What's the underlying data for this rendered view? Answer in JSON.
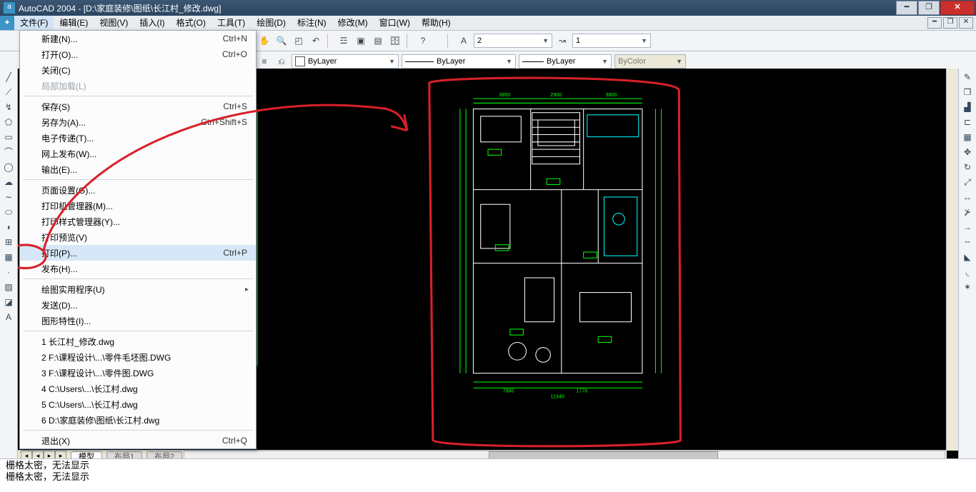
{
  "title": "AutoCAD 2004 - [D:\\家庭装修\\图纸\\长江村_修改.dwg]",
  "menubar": [
    "文件(F)",
    "编辑(E)",
    "视图(V)",
    "插入(I)",
    "格式(O)",
    "工具(T)",
    "绘图(D)",
    "标注(N)",
    "修改(M)",
    "窗口(W)",
    "帮助(H)"
  ],
  "file_menu": {
    "new": {
      "label": "新建(N)...",
      "sc": "Ctrl+N"
    },
    "open": {
      "label": "打开(O)...",
      "sc": "Ctrl+O"
    },
    "close": {
      "label": "关闭(C)"
    },
    "partial": {
      "label": "局部加载(L)"
    },
    "save": {
      "label": "保存(S)",
      "sc": "Ctrl+S"
    },
    "saveas": {
      "label": "另存为(A)...",
      "sc": "Ctrl+Shift+S"
    },
    "etransmit": {
      "label": "电子传递(T)..."
    },
    "publish_web": {
      "label": "网上发布(W)..."
    },
    "export": {
      "label": "输出(E)..."
    },
    "pagesetup": {
      "label": "页面设置(G)..."
    },
    "plotter": {
      "label": "打印机管理器(M)..."
    },
    "plotstyle": {
      "label": "打印样式管理器(Y)..."
    },
    "preview": {
      "label": "打印预览(V)"
    },
    "print": {
      "label": "打印(P)...",
      "sc": "Ctrl+P"
    },
    "publish": {
      "label": "发布(H)..."
    },
    "utilities": {
      "label": "绘图实用程序(U)"
    },
    "send": {
      "label": "发送(D)..."
    },
    "props": {
      "label": "图形特性(I)..."
    },
    "recent": [
      "1 长江村_修改.dwg",
      "2 F:\\课程设计\\...\\零件毛坯图.DWG",
      "3 F:\\课程设计\\...\\零件图.DWG",
      "4 C:\\Users\\...\\长江村.dwg",
      "5 C:\\Users\\...\\长江村.dwg",
      "6 D:\\家庭装修\\图纸\\长江村.dwg"
    ],
    "exit": {
      "label": "退出(X)",
      "sc": "Ctrl+Q"
    }
  },
  "toolbar2": {
    "lineweight": "2",
    "linetype_val": "1"
  },
  "props": {
    "color": "ByLayer",
    "ltype": "ByLayer",
    "lweight": "ByLayer",
    "plotstyle": "ByColor"
  },
  "model_tab": "模型",
  "layout_tabs": [
    "布局1",
    "布局2"
  ],
  "cmd": [
    "栅格太密，无法显示",
    "栅格太密，无法显示"
  ]
}
